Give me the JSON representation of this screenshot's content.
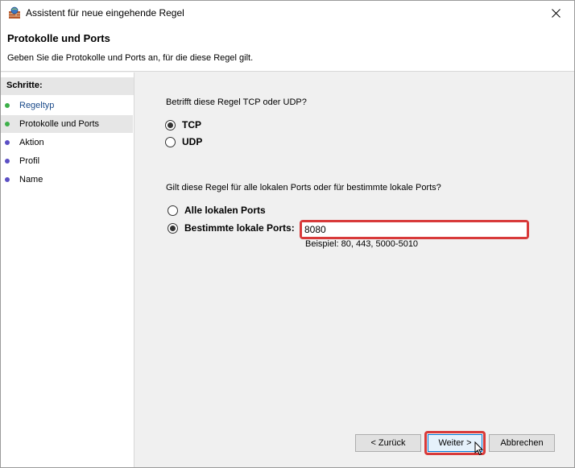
{
  "window": {
    "title": "Assistent für neue eingehende Regel"
  },
  "header": {
    "title": "Protokolle und Ports",
    "description": "Geben Sie die Protokolle und Ports an, für die diese Regel gilt."
  },
  "sidebar": {
    "heading": "Schritte:",
    "steps": [
      {
        "label": "Regeltyp",
        "state": "done",
        "dot_color": "#3db04a"
      },
      {
        "label": "Protokolle und Ports",
        "state": "active",
        "dot_color": "#3db04a"
      },
      {
        "label": "Aktion",
        "state": "pending",
        "dot_color": "#5b4fc4"
      },
      {
        "label": "Profil",
        "state": "pending",
        "dot_color": "#5b4fc4"
      },
      {
        "label": "Name",
        "state": "pending",
        "dot_color": "#5b4fc4"
      }
    ]
  },
  "protocol": {
    "question": "Betrifft diese Regel TCP oder UDP?",
    "options": [
      {
        "label": "TCP",
        "selected": true
      },
      {
        "label": "UDP",
        "selected": false
      }
    ]
  },
  "ports": {
    "question": "Gilt diese Regel für alle lokalen Ports oder für bestimmte lokale Ports?",
    "options": [
      {
        "label": "Alle lokalen Ports",
        "selected": false
      },
      {
        "label": "Bestimmte lokale Ports:",
        "selected": true
      }
    ],
    "value": "8080",
    "example": "Beispiel: 80, 443, 5000-5010"
  },
  "buttons": {
    "back": "< Zurück",
    "next": "Weiter >",
    "cancel": "Abbrechen"
  },
  "colors": {
    "highlight": "#d83a3a",
    "done_dot": "#3db04a",
    "pending_dot": "#5b4fc4"
  }
}
